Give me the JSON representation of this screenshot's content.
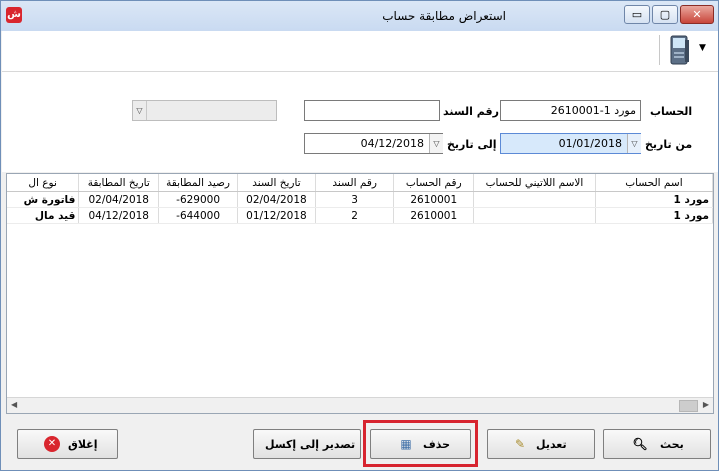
{
  "window": {
    "title": "استعراض مطابقة حساب",
    "min_label": "▭",
    "max_label": "▢",
    "close_label": "✕",
    "app_icon_text": "ش"
  },
  "form": {
    "account_label": "الحساب",
    "account_value": "2610001-مورد 1",
    "doc_number_label": "رقم السند",
    "doc_number_value": "",
    "from_date_label": "من تاريخ",
    "from_date_value": "01/01/2018",
    "to_date_label": "إلى تاريخ",
    "to_date_value": "04/12/2018",
    "extra_select_value": ""
  },
  "grid": {
    "columns": [
      "اسم الحساب",
      "الاسم اللاتيني للحساب",
      "رقم الحساب",
      "رقم السند",
      "تاريخ السند",
      "رصيد المطابقة",
      "تاريخ المطابقة",
      "نوع ال"
    ],
    "rows": [
      [
        "مورد 1",
        "",
        "2610001",
        "3",
        "02/04/2018",
        "629000-",
        "02/04/2018",
        "فاتورة ش"
      ],
      [
        "مورد 1",
        "",
        "2610001",
        "2",
        "01/12/2018",
        "644000-",
        "04/12/2018",
        "قيد مال"
      ]
    ]
  },
  "buttons": {
    "search": "بحث",
    "edit": "تعديل",
    "delete": "حذف",
    "export_excel": "تصدير إلى إكسل",
    "close": "إغلاق"
  },
  "colors": {
    "highlight_frame": "#d7242f",
    "selected_field": "#d7e9fb"
  }
}
